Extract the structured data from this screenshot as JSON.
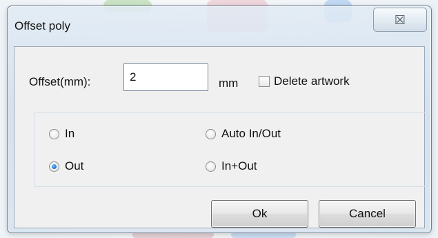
{
  "dialog": {
    "title": "Offset poly",
    "close_glyph": "☒"
  },
  "form": {
    "offset_label": "Offset(mm):",
    "offset_value": "2",
    "unit_label": "mm",
    "delete_artwork_label": "Delete artwork",
    "delete_artwork_checked": false
  },
  "options": {
    "in_label": "In",
    "auto_in_out_label": "Auto In/Out",
    "out_label": "Out",
    "in_plus_out_label": "In+Out",
    "selected": "Out"
  },
  "buttons": {
    "ok_label": "Ok",
    "cancel_label": "Cancel"
  },
  "icons": {
    "close": "close-icon",
    "checkbox": "checkbox-icon",
    "radio": "radio-icon"
  }
}
